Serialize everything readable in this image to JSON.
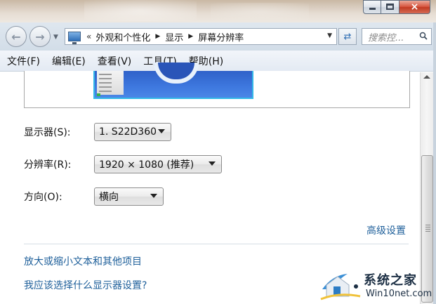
{
  "window": {
    "buttons": {
      "minimize": "minimize",
      "maximize": "maximize",
      "close": "×"
    }
  },
  "navbar": {
    "back_icon": "back-arrow-icon",
    "forward_icon": "forward-arrow-icon",
    "address": {
      "prefix": "«",
      "crumbs": [
        "外观和个性化",
        "显示",
        "屏幕分辨率"
      ]
    },
    "search_placeholder": "搜索控..."
  },
  "menubar": {
    "items": [
      "文件(F)",
      "编辑(E)",
      "查看(V)",
      "工具(T)",
      "帮助(H)"
    ]
  },
  "settings": {
    "display": {
      "label": "显示器(S):",
      "value": "1. S22D360"
    },
    "resolution": {
      "label": "分辨率(R):",
      "value": "1920 × 1080 (推荐)"
    },
    "orientation": {
      "label": "方向(O):",
      "value": "横向"
    },
    "advanced_link": "高级设置"
  },
  "links": {
    "text_size": "放大或缩小文本和其他项目",
    "which_settings": "我应该选择什么显示器设置?"
  },
  "watermark": {
    "title": "系统之家",
    "url": "Win10net.com"
  },
  "colors": {
    "link": "#1e5f9a",
    "menubar": "#e3eaf3",
    "close_button": "#c23a22"
  }
}
